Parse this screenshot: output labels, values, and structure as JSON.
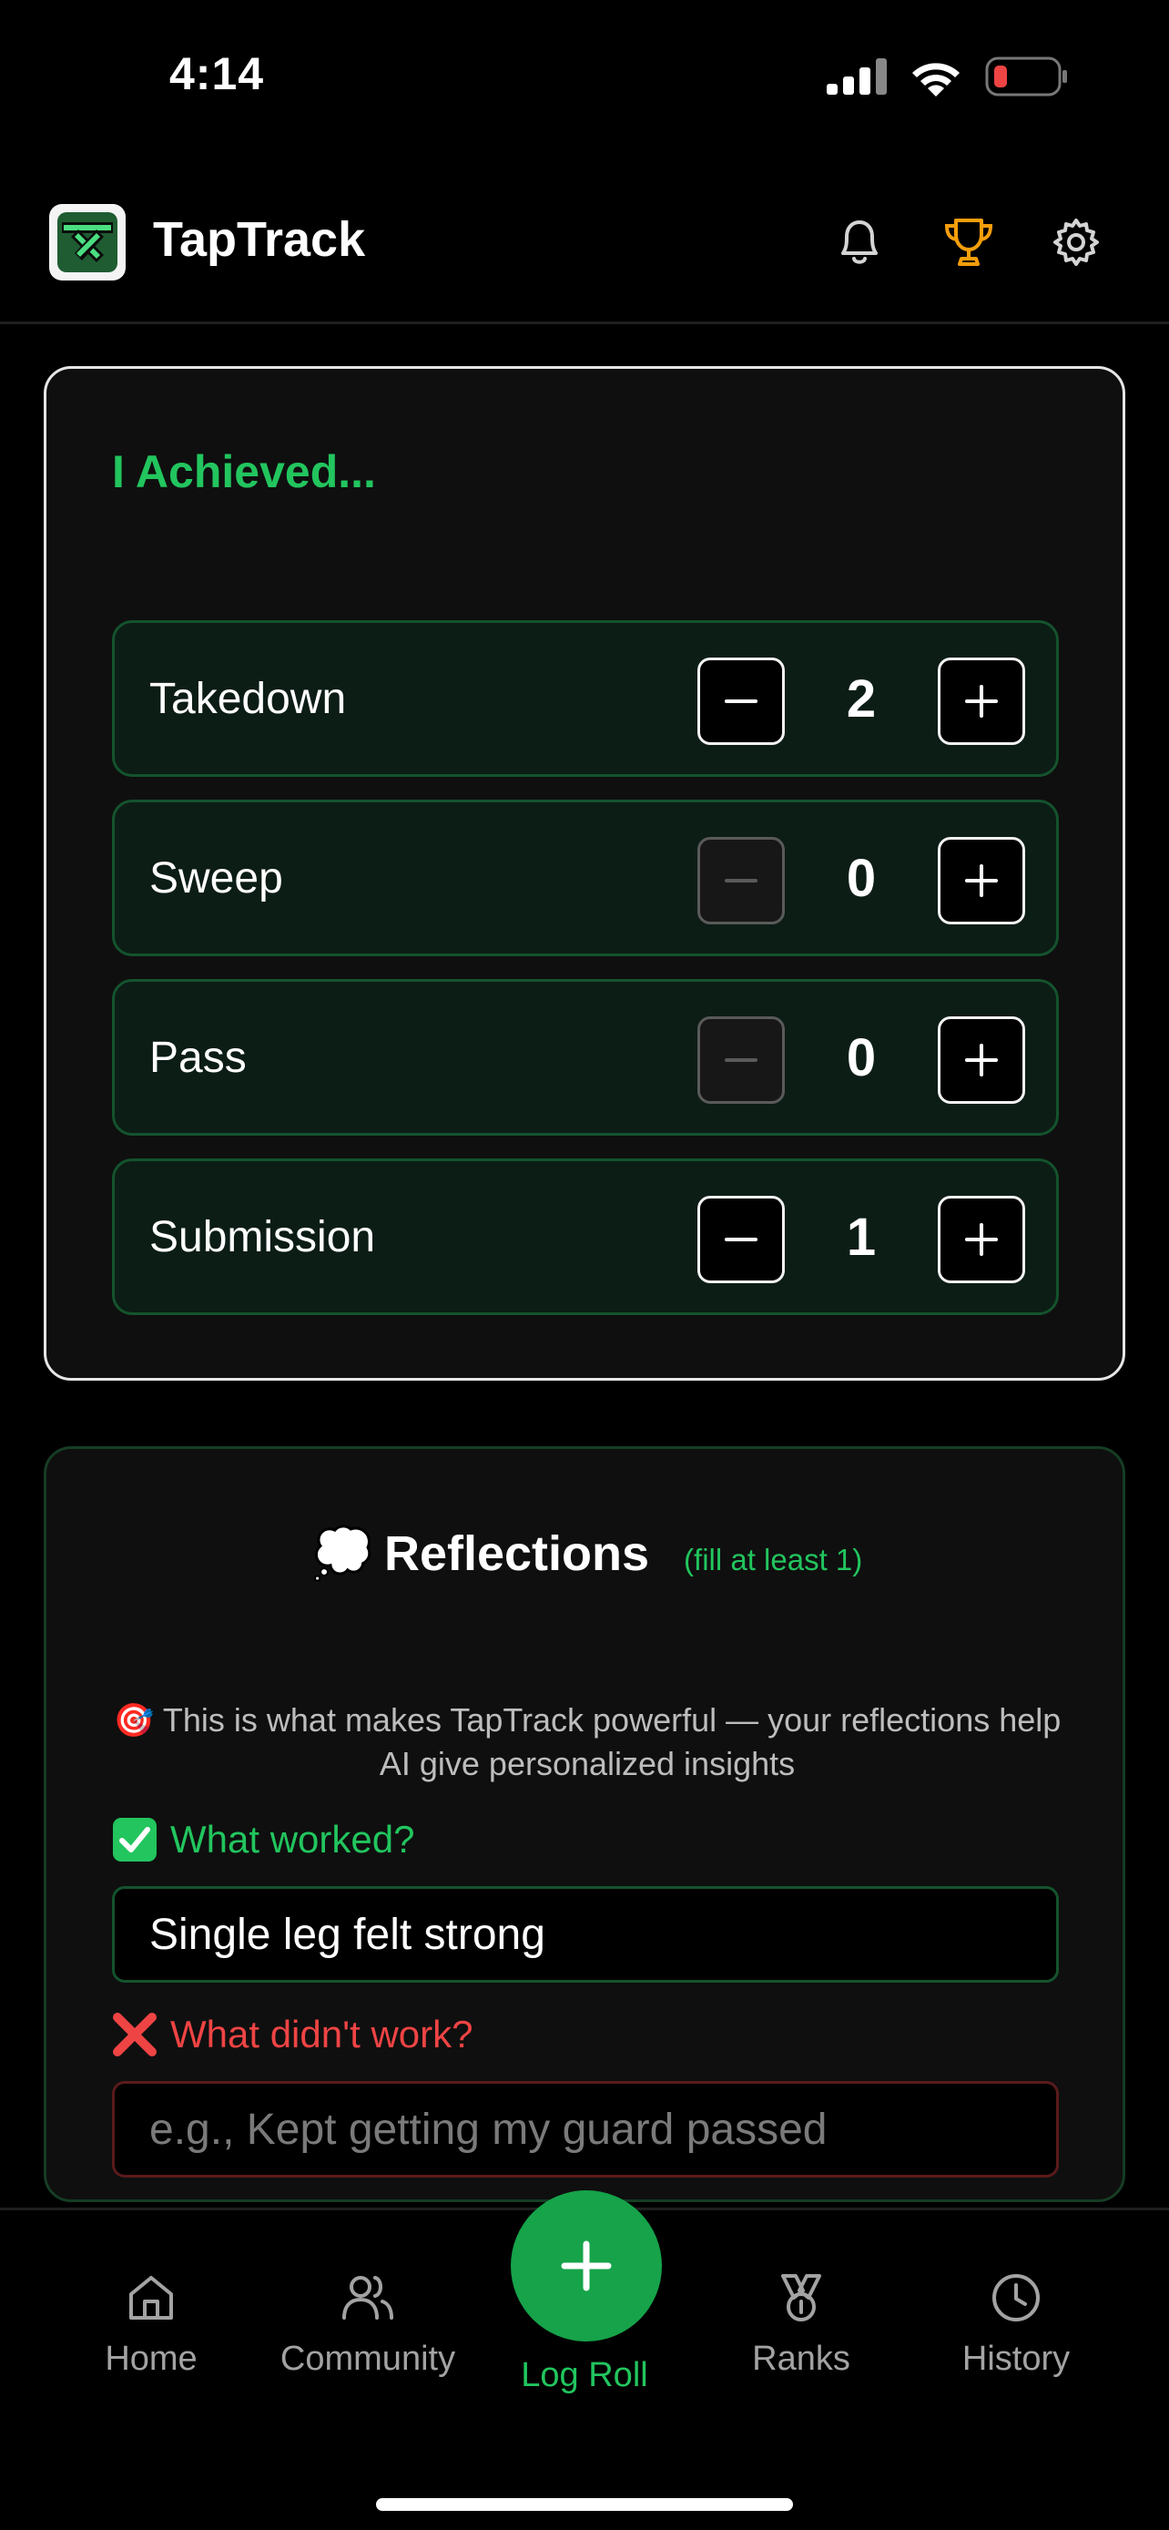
{
  "status_bar": {
    "time": "4:14",
    "battery_color": "#ef4444"
  },
  "header": {
    "title": "TapTrack",
    "trophy_color": "#f59e0b"
  },
  "achieved": {
    "title": "I Achieved...",
    "items": [
      {
        "label": "Takedown",
        "count": "2",
        "minus_enabled": true
      },
      {
        "label": "Sweep",
        "count": "0",
        "minus_enabled": false
      },
      {
        "label": "Pass",
        "count": "0",
        "minus_enabled": false
      },
      {
        "label": "Submission",
        "count": "1",
        "minus_enabled": true
      }
    ]
  },
  "reflections": {
    "emoji": "💭",
    "title": "Reflections",
    "subtitle": "(fill at least 1)",
    "description_emoji": "🎯",
    "description": "This is what makes TapTrack powerful — your reflections help AI give personalized insights",
    "worked_label": "What worked?",
    "worked_value": "Single leg felt strong",
    "didnt_label": "What didn't work?",
    "didnt_placeholder": "e.g., Kept getting my guard passed",
    "accent_green": "#22c55e",
    "accent_red": "#ef4444"
  },
  "nav": {
    "home": "Home",
    "community": "Community",
    "log_roll": "Log Roll",
    "ranks": "Ranks",
    "history": "History"
  }
}
